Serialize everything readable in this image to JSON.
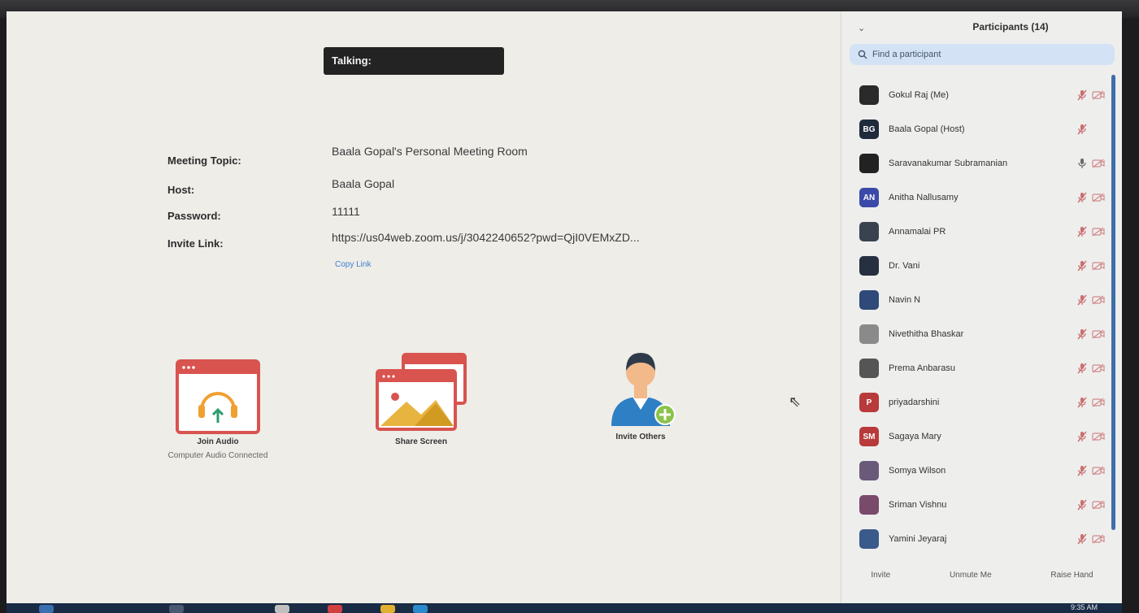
{
  "talking": {
    "label": "Talking:"
  },
  "meeting_info": {
    "topic_label": "Meeting Topic:",
    "topic_value": "Baala Gopal's Personal Meeting Room",
    "host_label": "Host:",
    "host_value": "Baala Gopal",
    "password_label": "Password:",
    "password_value": "11111",
    "invite_label": "Invite Link:",
    "invite_value": "https://us04web.zoom.us/j/3042240652?pwd=QjI0VEMxZD...",
    "copy_link": "Copy Link"
  },
  "actions": {
    "join_audio": {
      "label": "Join Audio",
      "sub": "Computer Audio Connected"
    },
    "share_screen": {
      "label": "Share Screen"
    },
    "invite_others": {
      "label": "Invite Others"
    }
  },
  "participants": {
    "title": "Participants (14)",
    "search_placeholder": "Find a participant",
    "items": [
      {
        "name": "Gokul Raj (Me)",
        "initials": "",
        "color": "#2a2a2a",
        "mic": "muted",
        "video": "off"
      },
      {
        "name": "Baala Gopal (Host)",
        "initials": "BG",
        "color": "#1f2a3a",
        "mic": "muted",
        "video": "none"
      },
      {
        "name": "Saravanakumar Subramanian",
        "initials": "",
        "color": "#222222",
        "mic": "on",
        "video": "off"
      },
      {
        "name": "Anitha Nallusamy",
        "initials": "AN",
        "color": "#3b4aa8",
        "mic": "muted",
        "video": "off"
      },
      {
        "name": "Annamalai PR",
        "initials": "",
        "color": "#3a4250",
        "mic": "muted",
        "video": "off"
      },
      {
        "name": "Dr. Vani",
        "initials": "",
        "color": "#263040",
        "mic": "muted",
        "video": "off"
      },
      {
        "name": "Navin N",
        "initials": "",
        "color": "#2f4a78",
        "mic": "muted",
        "video": "off"
      },
      {
        "name": "Nivethitha Bhaskar",
        "initials": "",
        "color": "#8a8a8a",
        "mic": "muted",
        "video": "off"
      },
      {
        "name": "Prema Anbarasu",
        "initials": "",
        "color": "#555555",
        "mic": "muted",
        "video": "off"
      },
      {
        "name": "priyadarshini",
        "initials": "P",
        "color": "#b83a3a",
        "mic": "muted",
        "video": "off"
      },
      {
        "name": "Sagaya Mary",
        "initials": "SM",
        "color": "#b83a3a",
        "mic": "muted",
        "video": "off"
      },
      {
        "name": "Somya Wilson",
        "initials": "",
        "color": "#6a5a7a",
        "mic": "muted",
        "video": "off"
      },
      {
        "name": "Sriman Vishnu",
        "initials": "",
        "color": "#7a4a6a",
        "mic": "muted",
        "video": "off"
      },
      {
        "name": "Yamini Jeyaraj",
        "initials": "",
        "color": "#3a5a8a",
        "mic": "muted",
        "video": "off"
      }
    ],
    "footer": {
      "invite": "Invite",
      "unmute": "Unmute Me",
      "raise_hand": "Raise Hand"
    }
  },
  "taskbar": {
    "clock": "9:35 AM"
  },
  "colors": {
    "accent_red": "#d9534f",
    "muted_icon": "#c96f6f",
    "search_bg": "#d3e3f5",
    "link": "#3f7fd0"
  }
}
